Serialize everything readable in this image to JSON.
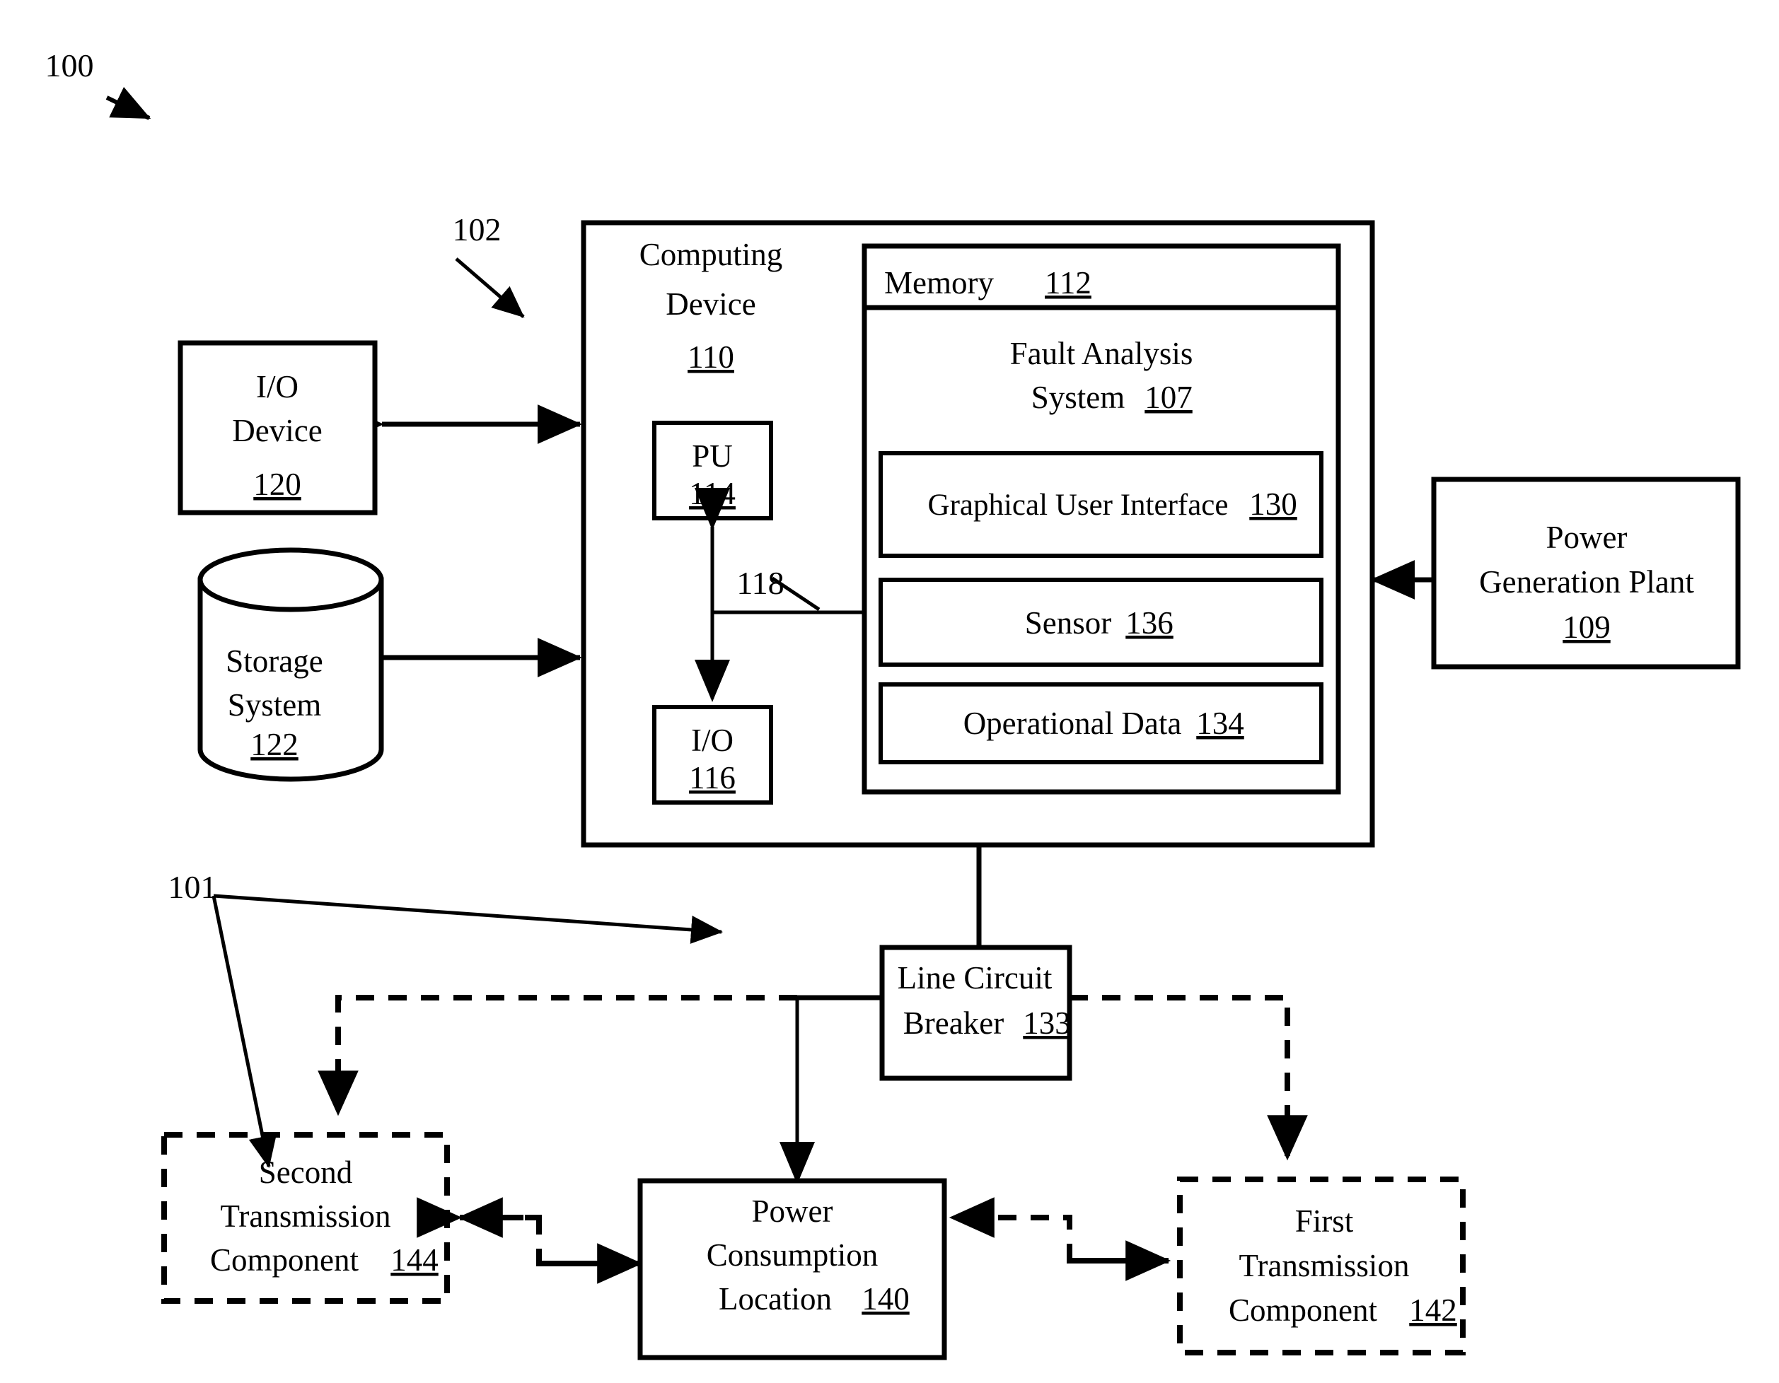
{
  "figure": {
    "reference_100": "100",
    "reference_102": "102",
    "reference_101": "101",
    "reference_118": "118"
  },
  "computing_device": {
    "title_line1": "Computing",
    "title_line2": "Device",
    "ref": "110",
    "pu": {
      "label": "PU",
      "ref": "114"
    },
    "io": {
      "label": "I/O",
      "ref": "116"
    },
    "bus_ref": "118"
  },
  "memory": {
    "label": "Memory",
    "ref": "112",
    "fault_analysis": {
      "title_line1": "Fault Analysis",
      "title_line2": "System",
      "ref": "107"
    },
    "modules": [
      {
        "label": "Graphical User Interface",
        "ref": "130"
      },
      {
        "label": "Sensor",
        "ref": "136"
      },
      {
        "label": "Operational Data",
        "ref": "134"
      }
    ]
  },
  "peripherals": [
    {
      "line1": "I/O",
      "line2": "Device",
      "ref": "120",
      "shape": "rect"
    },
    {
      "line1": "Storage",
      "line2": "System",
      "ref": "122",
      "shape": "cylinder"
    }
  ],
  "power_generation_plant": {
    "line1": "Power",
    "line2": "Generation Plant",
    "ref": "109"
  },
  "line_circuit_breaker": {
    "line1": "Line Circuit",
    "line2": "Breaker",
    "ref": "133"
  },
  "power_consumption_location": {
    "line1": "Power",
    "line2": "Consumption",
    "line3": "Location",
    "ref": "140"
  },
  "first_transmission_component": {
    "line1": "First",
    "line2": "Transmission",
    "line3": "Component",
    "ref": "142"
  },
  "second_transmission_component": {
    "line1": "Second",
    "line2": "Transmission",
    "line3": "Component",
    "ref": "144"
  },
  "colors": {
    "ink": "#000000",
    "paper": "#ffffff"
  }
}
